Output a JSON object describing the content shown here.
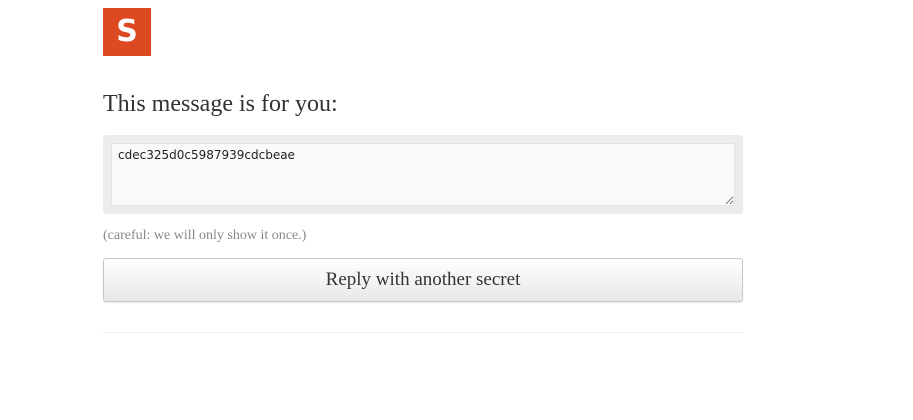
{
  "logo": {
    "letter": "S",
    "color": "#dd4a22"
  },
  "message": {
    "title": "This message is for you:",
    "secret_value": "cdec325d0c5987939cdcbeae",
    "note": "(careful: we will only show it once.)"
  },
  "actions": {
    "reply_label": "Reply with another secret"
  }
}
